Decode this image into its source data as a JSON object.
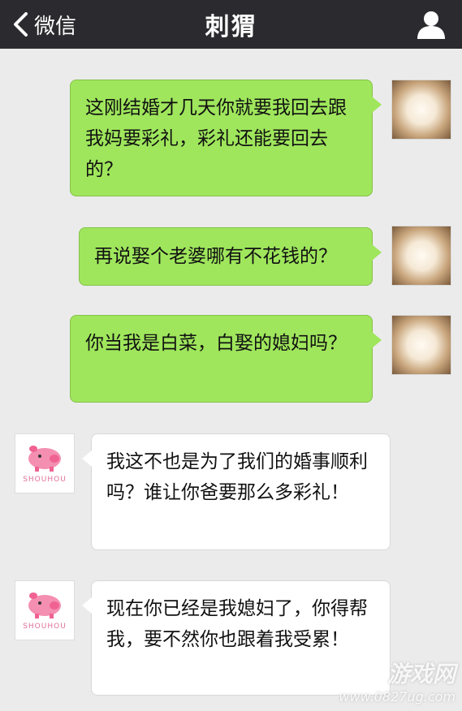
{
  "header": {
    "back_label": "微信",
    "title": "刺猬"
  },
  "messages": [
    {
      "side": "right",
      "text": "这刚结婚才几天你就要我回去跟我妈要彩礼，彩礼还能要回去的？"
    },
    {
      "side": "right",
      "text": "再说娶个老婆哪有不花钱的？"
    },
    {
      "side": "right",
      "text": "你当我是白菜，白娶的媳妇吗？"
    },
    {
      "side": "left",
      "text": "我这不也是为了我们的婚事顺利吗？谁让你爸要那么多彩礼！",
      "avatar_caption": "SHOUHOU"
    },
    {
      "side": "left",
      "text": "现在你已经是我媳妇了，你得帮我，要不然你也跟着我受累！",
      "avatar_caption": "SHOUHOU"
    }
  ],
  "watermark": {
    "logo": "游戏网",
    "url": "www.0827ug.com"
  },
  "colors": {
    "topbar": "#2b2b2f",
    "background": "#ebebeb",
    "my_bubble": "#9fe65c",
    "their_bubble": "#ffffff"
  },
  "icons": {
    "back": "chevron-left-icon",
    "profile": "person-icon",
    "avatar_left": "pink-pig-icon"
  }
}
